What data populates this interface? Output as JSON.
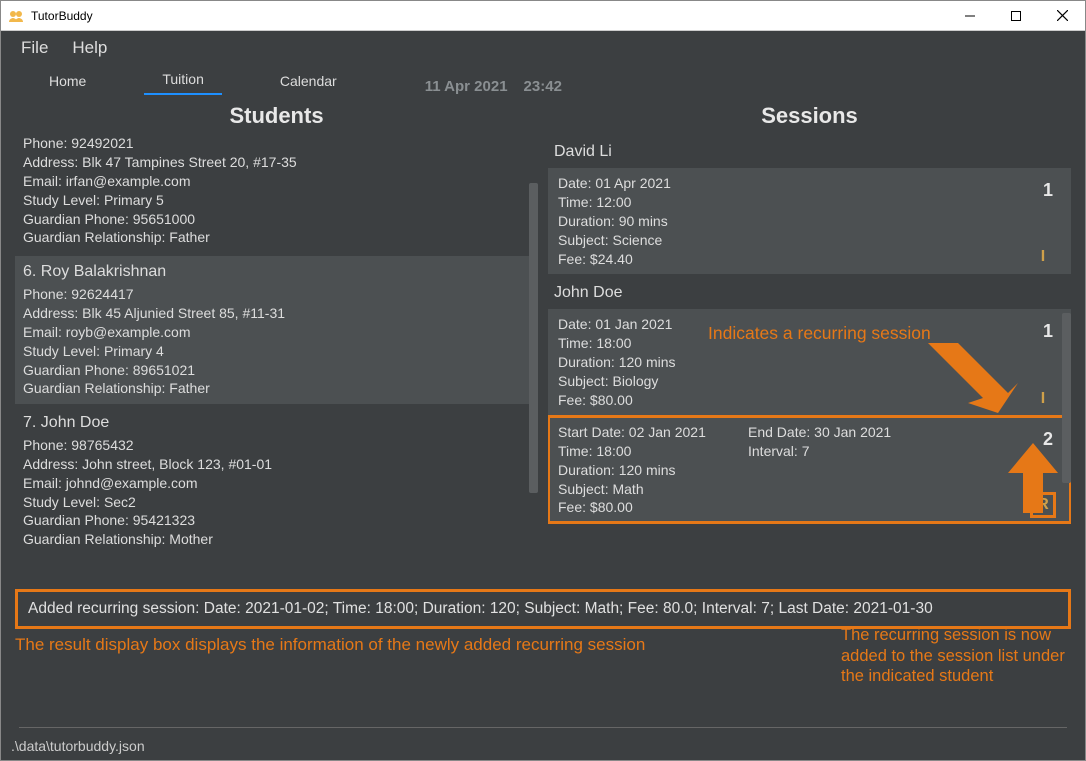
{
  "app": {
    "title": "TutorBuddy"
  },
  "menu": {
    "file": "File",
    "help": "Help"
  },
  "tabs": {
    "home": "Home",
    "tuition": "Tuition",
    "calendar": "Calendar"
  },
  "datetime": {
    "date": "11 Apr 2021",
    "time": "23:42"
  },
  "headings": {
    "students": "Students",
    "sessions": "Sessions"
  },
  "students": [
    {
      "phone": "Phone: 92492021",
      "address": "Address: Blk 47 Tampines Street 20, #17-35",
      "email": "Email: irfan@example.com",
      "level": "Study Level: Primary 5",
      "gphone": "Guardian Phone: 95651000",
      "grel": "Guardian Relationship: Father"
    },
    {
      "name": "6.   Roy Balakrishnan",
      "phone": "Phone: 92624417",
      "address": "Address: Blk 45 Aljunied Street 85, #11-31",
      "email": "Email: royb@example.com",
      "level": "Study Level: Primary 4",
      "gphone": "Guardian Phone: 89651021",
      "grel": "Guardian Relationship: Father",
      "selected": true
    },
    {
      "name": "7.   John Doe",
      "phone": "Phone: 98765432",
      "address": "Address: John street, Block 123, #01-01",
      "email": "Email: johnd@example.com",
      "level": "Study Level: Sec2",
      "gphone": "Guardian Phone: 95421323",
      "grel": "Guardian Relationship: Mother"
    }
  ],
  "sessions": {
    "groups": [
      {
        "owner": "David Li",
        "items": [
          {
            "lines": [
              "Date: 01 Apr 2021",
              "Time: 12:00",
              "Duration: 90 mins",
              "Subject: Science",
              "Fee: $24.40"
            ],
            "num": "1",
            "type": "I"
          }
        ]
      },
      {
        "owner": "John Doe",
        "items": [
          {
            "lines": [
              "Date: 01 Jan 2021",
              "Time: 18:00",
              "Duration: 120 mins",
              "Subject: Biology",
              "Fee: $80.00"
            ],
            "num": "1",
            "type": "I"
          },
          {
            "left": [
              "Start Date: 02 Jan 2021",
              "Time: 18:00",
              "Duration: 120 mins",
              "Subject: Math",
              "Fee: $80.00"
            ],
            "right": [
              "End Date: 30 Jan 2021",
              "Interval: 7"
            ],
            "num": "2",
            "type": "R",
            "highlight": true
          }
        ]
      }
    ]
  },
  "annotations": {
    "recurring_indicator": "Indicates a recurring session",
    "result_caption": "The result display box displays the information of the newly added recurring session",
    "added_caption": "The recurring session is now added to the session list under the indicated student"
  },
  "result_text": "Added recurring session: Date: 2021-01-02; Time: 18:00; Duration: 120; Subject: Math; Fee: 80.0; Interval: 7; Last Date: 2021-01-30",
  "statusbar": ".\\data\\tutorbuddy.json"
}
